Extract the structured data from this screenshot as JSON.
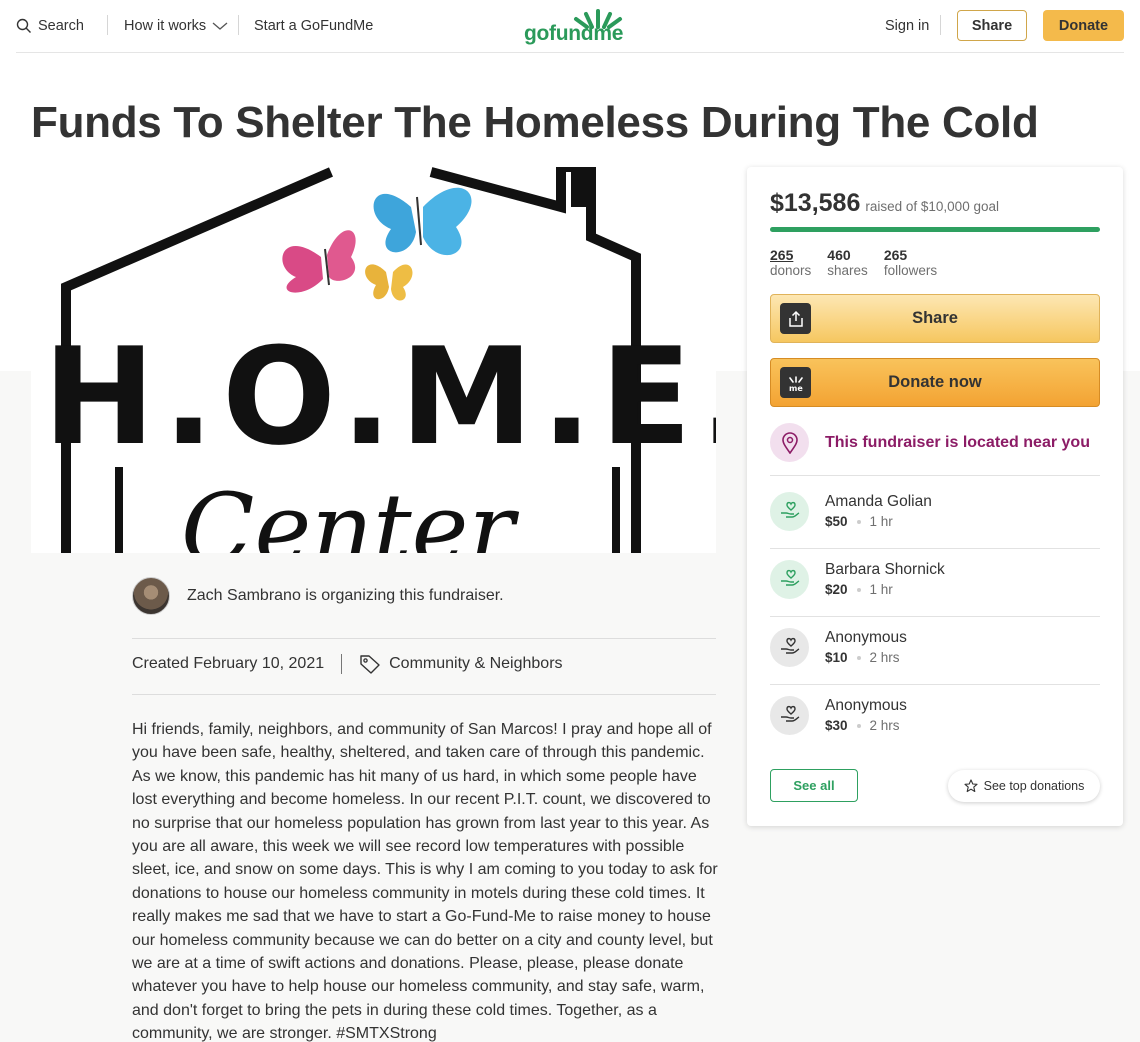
{
  "header": {
    "search_label": "Search",
    "how_label": "How it works",
    "start_label": "Start a GoFundMe",
    "logo_text": "gofundme",
    "signin_label": "Sign in",
    "share_label": "Share",
    "donate_label": "Donate"
  },
  "page": {
    "title": "Funds To Shelter The Homeless During The Cold"
  },
  "hero": {
    "image_text": "H.O.M.E.",
    "script_text": "Center"
  },
  "organizer": {
    "text": "Zach Sambrano is organizing this fundraiser."
  },
  "meta": {
    "created": "Created February 10, 2021",
    "category": "Community & Neighbors"
  },
  "story": "Hi friends, family, neighbors, and community of San Marcos! I pray and hope all of you have been safe, healthy, sheltered, and taken care of through this pandemic. As we know, this pandemic has hit many of us hard, in which some people have lost everything and become homeless.  In our recent P.I.T. count, we discovered to no surprise that our homeless population has grown from last year to this year. As you are all aware, this week we will see record low temperatures with possible sleet, ice, and snow on some days. This is why I am coming to you today to ask for donations to house our homeless community in motels during these cold times. It really makes me sad that we have to start a Go-Fund-Me to raise money to house our homeless community because we can do better on a city and county level, but we are at a time of swift actions and donations. Please, please, please donate whatever you have to help house our homeless community, and stay safe, warm, and don't forget to bring the pets in during these cold times. Together, as a community, we are stronger. #SMTXStrong",
  "card": {
    "raised_amount": "$13,586",
    "goal_text": "raised of $10,000 goal",
    "progress_fraction": 1.0,
    "stats": [
      {
        "n": "265",
        "l": "donors"
      },
      {
        "n": "460",
        "l": "shares"
      },
      {
        "n": "265",
        "l": "followers"
      }
    ],
    "share_label": "Share",
    "donate_label": "Donate now",
    "near_text": "This fundraiser is located near you",
    "donations": [
      {
        "name": "Amanda Golian",
        "amount": "$50",
        "time": "1 hr"
      },
      {
        "name": "Barbara Shornick",
        "amount": "$20",
        "time": "1 hr"
      },
      {
        "name": "Anonymous",
        "amount": "$10",
        "time": "2 hrs"
      },
      {
        "name": "Anonymous",
        "amount": "$30",
        "time": "2 hrs"
      }
    ],
    "see_all_label": "See all",
    "see_top_label": "See top donations"
  },
  "colors": {
    "brand_green": "#2ea060",
    "donate_orange": "#f4ba4b",
    "near_purple": "#8c1c66"
  }
}
